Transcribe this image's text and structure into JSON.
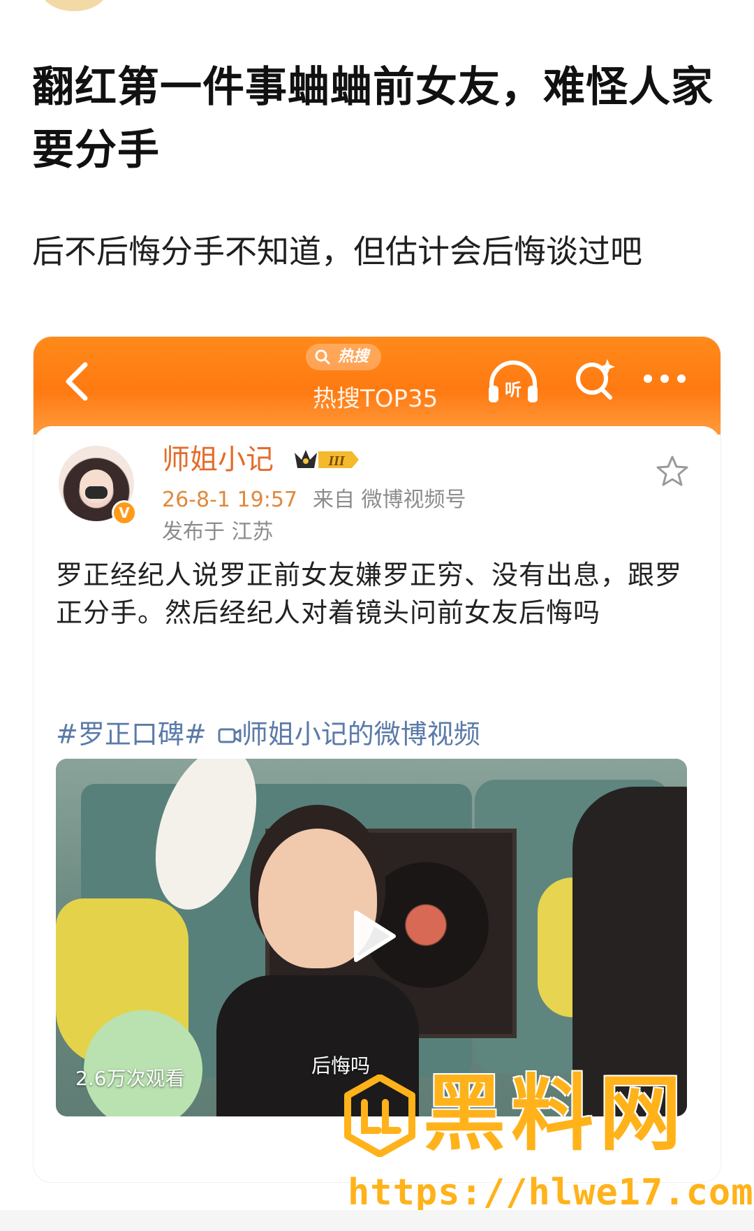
{
  "article": {
    "title": "翻红第一件事蛐蛐前女友，难怪人家要分手",
    "subtitle": "后不后悔分手不知道，但估计会后悔谈过吧"
  },
  "embedded_screenshot": {
    "header": {
      "hot_pill": "热搜",
      "title": "热搜TOP35"
    },
    "post": {
      "author": "师姐小记",
      "vip_badge": "V",
      "level_badge": "III",
      "time": "26-8-1 19:57",
      "source": "来自 微博视频号",
      "location": "发布于 江苏",
      "text": "罗正经纪人说罗正前女友嫌罗正穷、没有出息，跟罗正分手。然后经纪人对着镜头问前女友后悔吗",
      "hashtag": "#罗正口碑#",
      "video_link": "师姐小记的微博视频"
    },
    "video": {
      "view_count": "2.6万次观看",
      "caption": "后悔吗"
    }
  },
  "watermark": {
    "brand": "黑料网",
    "url": "https://hlwe17.com"
  },
  "colors": {
    "header_orange": "#ff7a12",
    "author_orange": "#e36c2a",
    "link_blue": "#5b7aa8",
    "watermark_gold": "#ffb21a"
  }
}
